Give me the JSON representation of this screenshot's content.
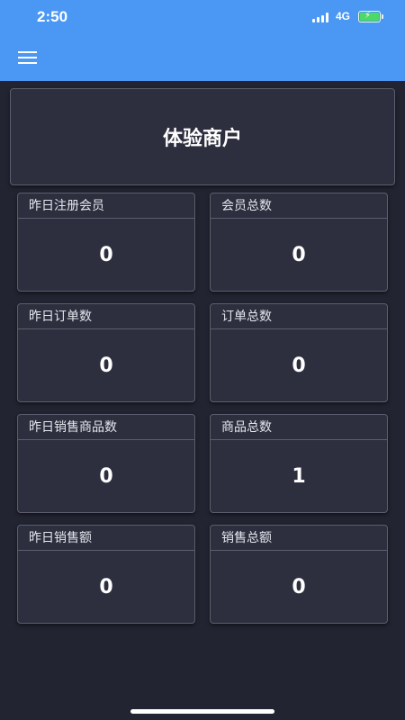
{
  "status_bar": {
    "time": "2:50",
    "network": "4G",
    "signal_icon": "signal-bars-icon",
    "battery_icon": "battery-charging-icon"
  },
  "toolbar": {
    "menu_icon": "hamburger-menu-icon",
    "color": "#4b97f4"
  },
  "merchant": {
    "name": "体验商户"
  },
  "stats": [
    {
      "label": "昨日注册会员",
      "value": "0"
    },
    {
      "label": "会员总数",
      "value": "0"
    },
    {
      "label": "昨日订单数",
      "value": "0"
    },
    {
      "label": "订单总数",
      "value": "0"
    },
    {
      "label": "昨日销售商品数",
      "value": "0"
    },
    {
      "label": "商品总数",
      "value": "1"
    },
    {
      "label": "昨日销售额",
      "value": "0"
    },
    {
      "label": "销售总额",
      "value": "0"
    }
  ],
  "colors": {
    "background": "#222431",
    "card": "#2d2f3e",
    "card_border": "#5b5e6e",
    "battery": "#4cd964"
  }
}
